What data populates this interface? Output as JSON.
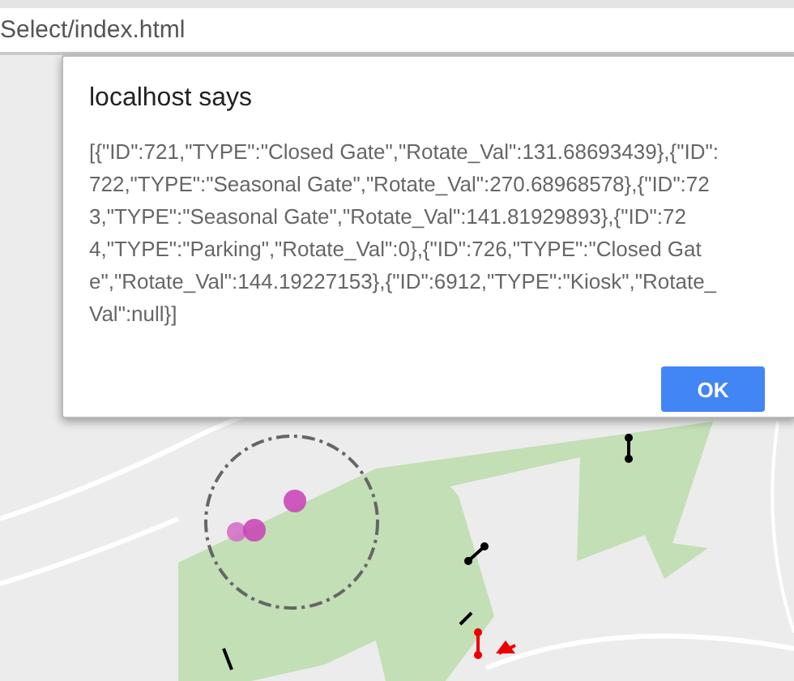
{
  "address_bar": {
    "url": "Select/index.html"
  },
  "dialog": {
    "title": "localhost says",
    "message": "[{\"ID\":721,\"TYPE\":\"Closed Gate\",\"Rotate_Val\":131.68693439},{\"ID\":722,\"TYPE\":\"Seasonal Gate\",\"Rotate_Val\":270.68968578},{\"ID\":723,\"TYPE\":\"Seasonal Gate\",\"Rotate_Val\":141.81929893},{\"ID\":724,\"TYPE\":\"Parking\",\"Rotate_Val\":0},{\"ID\":726,\"TYPE\":\"Closed Gate\",\"Rotate_Val\":144.19227153},{\"ID\":6912,\"TYPE\":\"Kiosk\",\"Rotate_Val\":null}]",
    "buttons": [
      {
        "label": "OK",
        "kind": "primary"
      }
    ]
  }
}
